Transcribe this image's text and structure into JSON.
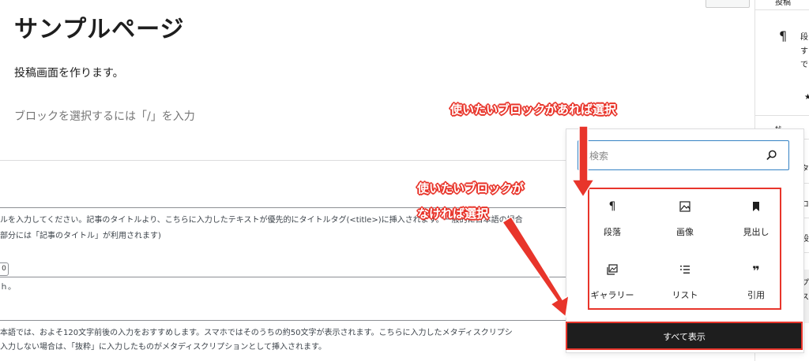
{
  "editor": {
    "title": "サンプルページ",
    "paragraph": "投稿画面を作ります。",
    "block_placeholder": "ブロックを選択するには「/」を入力",
    "top_button": "",
    "meta": {
      "title_help_1": "ルを入力してください。記事のタイトルより、こちらに入力したテキストが優先的にタイトルタグ(<title>)に挿入されます。一般的に日本語の場合",
      "title_help_2": "部分には「記事のタイトル」が利用されます)",
      "counter": "0",
      "small_note": "ｈ。",
      "desc_help_1": "本語では、およそ120文字前後の入力をおすすめします。スマホではそのうちの約50文字が表示されます。こちらに入力したメタディスクリプシ",
      "desc_help_2": "入力しない場合は、「抜粋」に入力したものがメタディスクリプションとして挿入されます。"
    }
  },
  "sidebar": {
    "tab": "投稿",
    "block_icon": "paragraph-icon",
    "desc_1": "段",
    "desc_2": "す",
    "desc_3": "で",
    "star": "★",
    "item_1": "ｻﾀ",
    "item_2": "タ",
    "item_3": "コ",
    "item_4": "設",
    "item_5": "プ",
    "item_6": "ス"
  },
  "inserter": {
    "search_placeholder": "検索",
    "blocks": [
      {
        "label": "段落",
        "icon": "paragraph-icon"
      },
      {
        "label": "画像",
        "icon": "image-icon"
      },
      {
        "label": "見出し",
        "icon": "bookmark-icon"
      },
      {
        "label": "ギャラリー",
        "icon": "gallery-icon"
      },
      {
        "label": "リスト",
        "icon": "list-icon"
      },
      {
        "label": "引用",
        "icon": "quote-icon"
      }
    ],
    "show_all": "すべて表示"
  },
  "annotations": {
    "top": "使いたいブロックがあれば選択",
    "middle_1": "使いたいブロックが",
    "middle_2": "なければ選択"
  },
  "colors": {
    "accent_red": "#e8352b",
    "focus_blue": "#3582c4",
    "dark": "#1e1e1e"
  }
}
